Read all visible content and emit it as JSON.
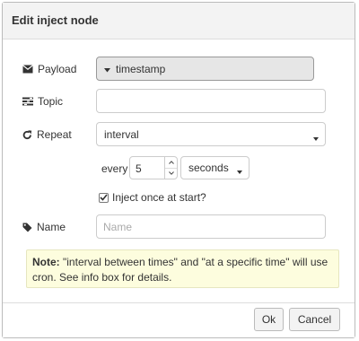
{
  "dialog": {
    "title": "Edit inject node"
  },
  "payload": {
    "label": "Payload",
    "value": "timestamp"
  },
  "topic": {
    "label": "Topic",
    "value": "",
    "placeholder": ""
  },
  "repeat": {
    "label": "Repeat",
    "value": "interval",
    "every_label": "every",
    "every_value": "5",
    "unit": "seconds"
  },
  "inject_once": {
    "label": "Inject once at start?",
    "checked": true
  },
  "name": {
    "label": "Name",
    "value": "",
    "placeholder": "Name"
  },
  "note": {
    "bold": "Note:",
    "text": " \"interval between times\" and \"at a specific time\" will use cron. See info box for details."
  },
  "buttons": {
    "ok": "Ok",
    "cancel": "Cancel"
  },
  "icons": {
    "payload": "envelope-icon",
    "topic": "tasks-icon",
    "repeat": "repeat-icon",
    "name": "tag-icon"
  }
}
